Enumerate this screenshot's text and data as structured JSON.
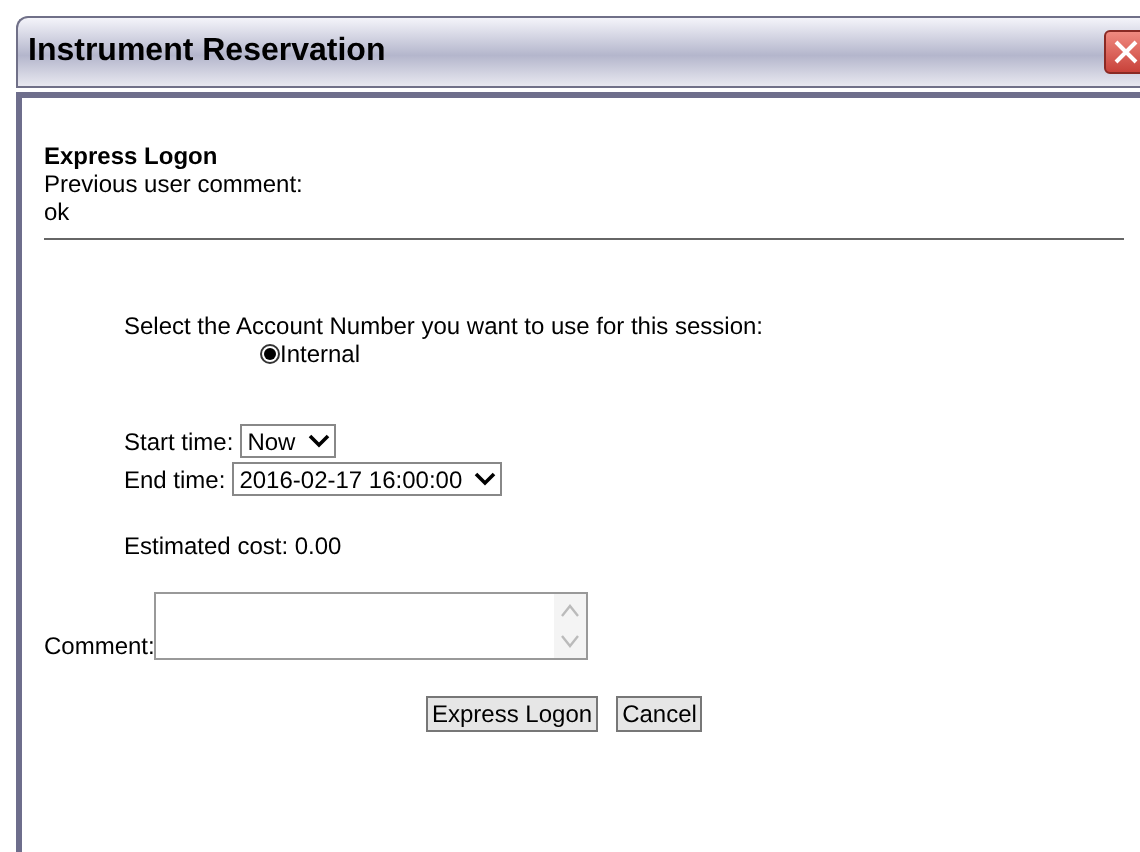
{
  "window": {
    "title": "Instrument Reservation"
  },
  "header": {
    "title": "Express Logon",
    "comment_label": "Previous user comment:",
    "comment": "ok"
  },
  "account": {
    "prompt": "Select the Account Number you want to use for this session:",
    "options": [
      {
        "label": "Internal",
        "selected": true
      }
    ]
  },
  "start_time": {
    "label": "Start time:",
    "value": "Now"
  },
  "end_time": {
    "label": "End time:",
    "value": "2016-02-17 16:00:00"
  },
  "estimated_cost": "Estimated cost: 0.00",
  "comment": {
    "label": "Comment:"
  },
  "buttons": [
    "Express Logon",
    "Cancel"
  ]
}
